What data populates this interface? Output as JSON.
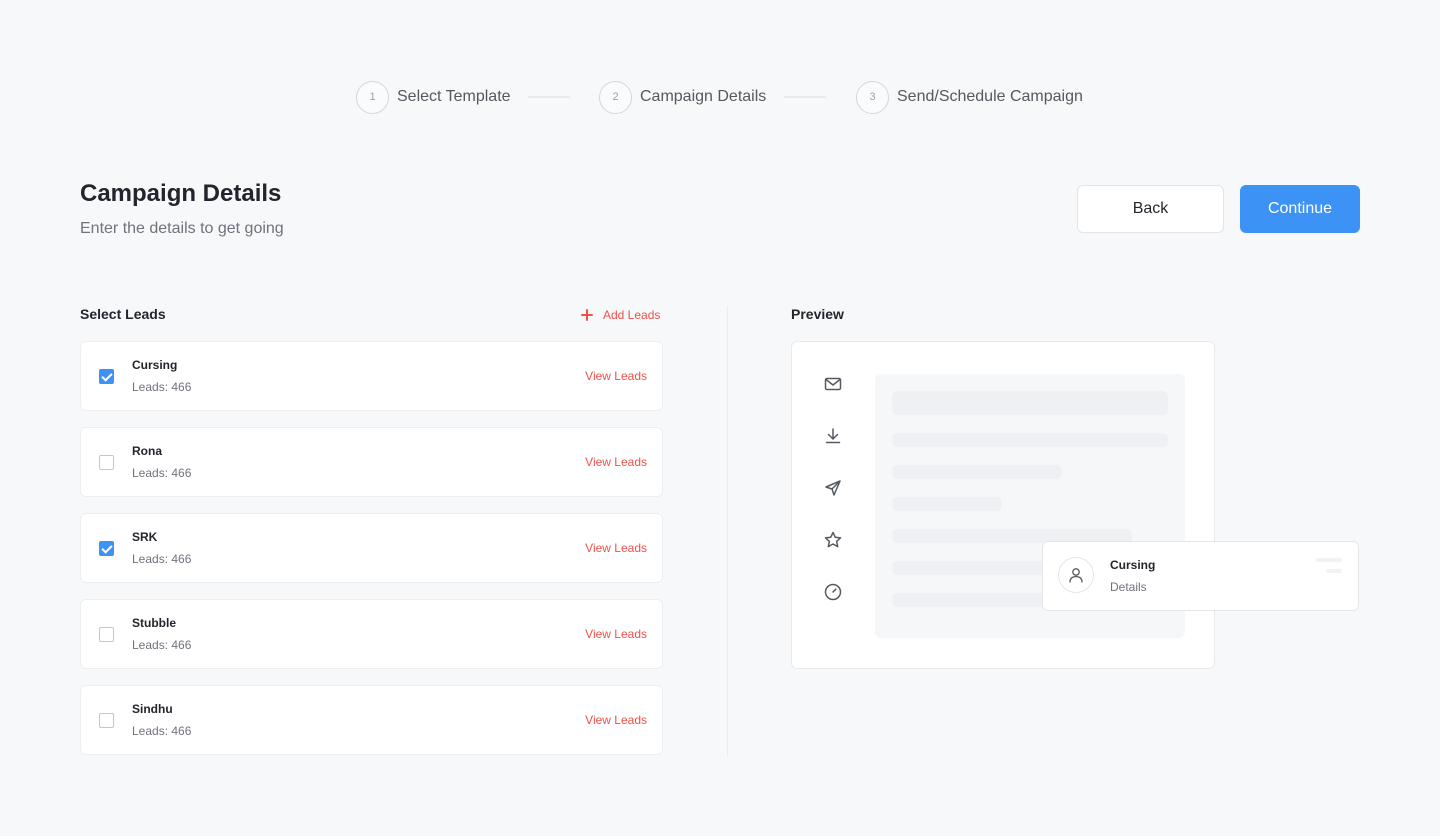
{
  "stepper": {
    "steps": [
      {
        "number": "1",
        "label": "Select Template"
      },
      {
        "number": "2",
        "label": "Campaign Details"
      },
      {
        "number": "3",
        "label": "Send/Schedule Campaign"
      }
    ]
  },
  "header": {
    "title": "Campaign Details",
    "subtitle": "Enter the details to get going",
    "back_label": "Back",
    "continue_label": "Continue"
  },
  "leads": {
    "section_label": "Select Leads",
    "add_label": "Add Leads",
    "view_label": "View Leads",
    "items": [
      {
        "name": "Cursing",
        "count": "Leads: 466",
        "checked": true
      },
      {
        "name": "Rona",
        "count": "Leads: 466",
        "checked": false
      },
      {
        "name": "SRK",
        "count": "Leads: 466",
        "checked": true
      },
      {
        "name": "Stubble",
        "count": "Leads: 466",
        "checked": false
      },
      {
        "name": "Sindhu",
        "count": "Leads: 466",
        "checked": false
      }
    ]
  },
  "preview": {
    "section_label": "Preview",
    "icons": [
      "mail-icon",
      "download-icon",
      "send-icon",
      "star-icon",
      "clock-icon"
    ],
    "card": {
      "title": "Cursing",
      "subtitle": "Details"
    }
  },
  "colors": {
    "accent": "#3d93f5",
    "link": "#f0504a",
    "background": "#f7f8fa"
  }
}
